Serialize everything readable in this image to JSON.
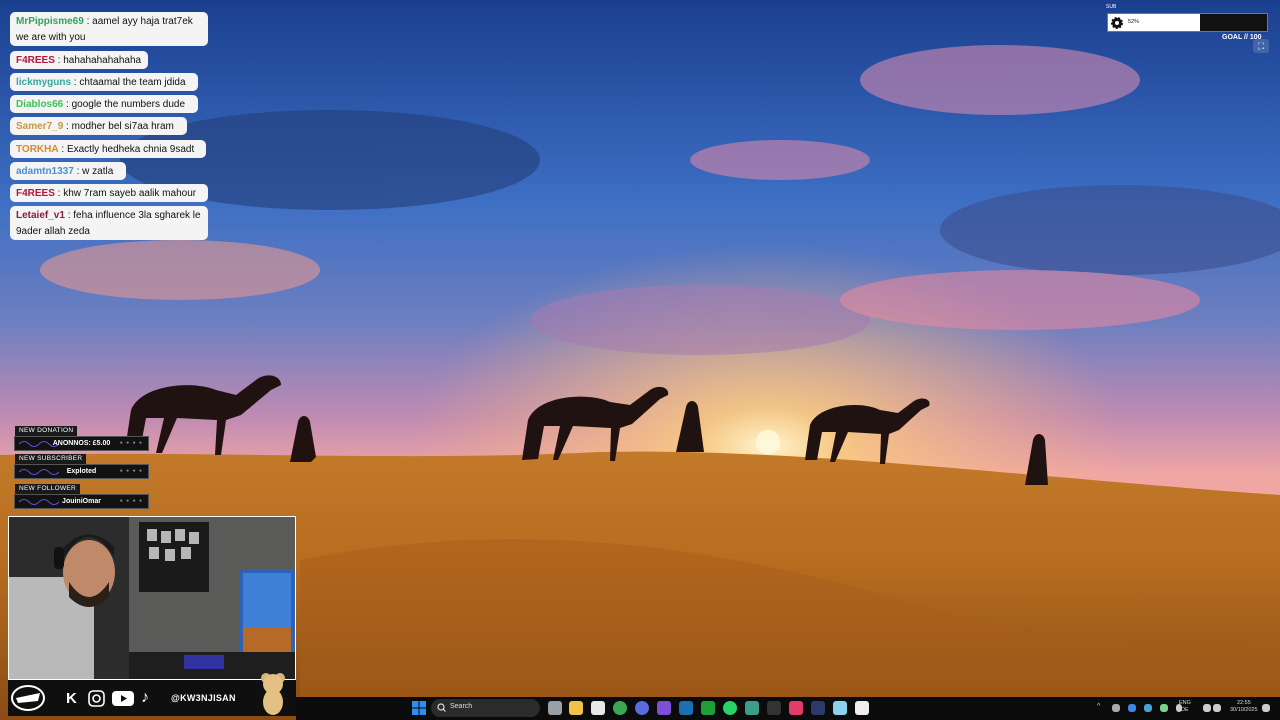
{
  "chat": {
    "messages": [
      {
        "user": "MrPippisme69",
        "color": "#2fa35a",
        "text": "aamel ayy haja trat7ek we are with you"
      },
      {
        "user": "F4REES",
        "color": "#b0183c",
        "text": "hahahahahahaha"
      },
      {
        "user": "lickmyguns",
        "color": "#37a6a0",
        "text": "chtaamal the team jdida"
      },
      {
        "user": "Diablos66",
        "color": "#3fbf5a",
        "text": "google the numbers dude"
      },
      {
        "user": "Samer7_9",
        "color": "#c79a3c",
        "text": "modher bel si7aa hram"
      },
      {
        "user": "TORKHA",
        "color": "#d78a2a",
        "text": "Exactly hedheka chnia 9sadt"
      },
      {
        "user": "adamtn1337",
        "color": "#4a8fd6",
        "text": "w zatla"
      },
      {
        "user": "F4REES",
        "color": "#b0183c",
        "text": "khw 7ram sayeb aalik mahour"
      },
      {
        "user": "Letaief_v1",
        "color": "#8a1c3a",
        "text": "feha influence 3la sgharek le 9ader allah zeda"
      }
    ]
  },
  "alerts": {
    "donation": {
      "label": "NEW DONATION",
      "value": "ANONNOS: £5.00"
    },
    "subscriber": {
      "label": "NEW SUBSCRIBER",
      "value": "Exploted"
    },
    "follower": {
      "label": "NEW FOLLOWER",
      "value": "JouiniOmar"
    }
  },
  "sub_goal": {
    "label": "SUB",
    "percent_text": "52%",
    "progress": 0.58,
    "goal_text": "GOAL // 100"
  },
  "social": {
    "handle": "@KW3NJISAN",
    "icons": [
      "kick-icon",
      "instagram-icon",
      "youtube-icon",
      "tiktok-icon"
    ]
  },
  "taskbar": {
    "search_placeholder": "Search",
    "language_top": "ENG",
    "language_bottom": "DE",
    "time": "22:55",
    "date": "30/10/2025"
  },
  "colors": {
    "chat_bg": "#f4f4f4",
    "taskbar_bg": "#0b0b0c",
    "windows_blue": "#2f8cf0"
  }
}
